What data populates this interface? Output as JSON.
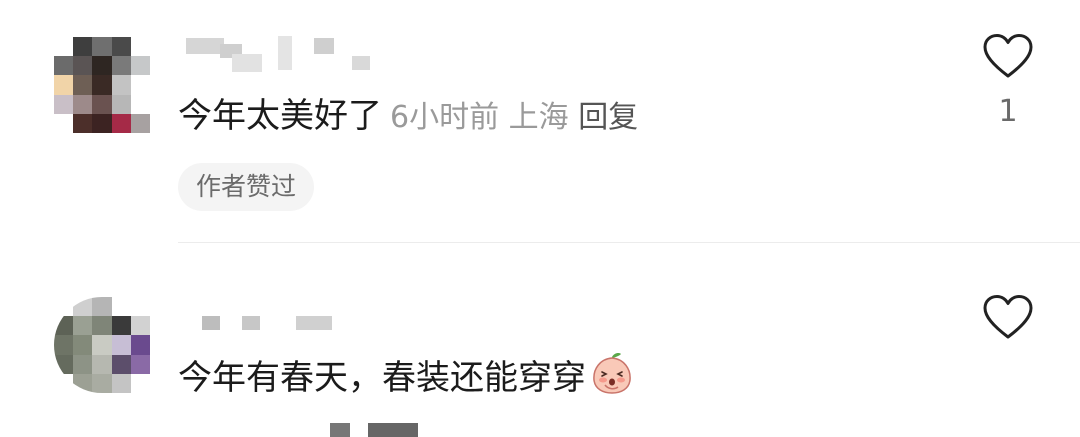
{
  "comments": [
    {
      "text": "今年太美好了",
      "time": "6小时前",
      "location": "上海",
      "reply_label": "回复",
      "like_count": "1",
      "badge": "作者赞过"
    },
    {
      "text": "今年有春天，春装还能穿穿"
    }
  ],
  "colors": {
    "text": "#1b1b1b",
    "meta": "#9a9a9a",
    "badge_bg": "#f4f4f4",
    "divider": "#ececec"
  },
  "icons": {
    "like": "heart-outline-icon",
    "emoji": "peach-face-emoji"
  }
}
